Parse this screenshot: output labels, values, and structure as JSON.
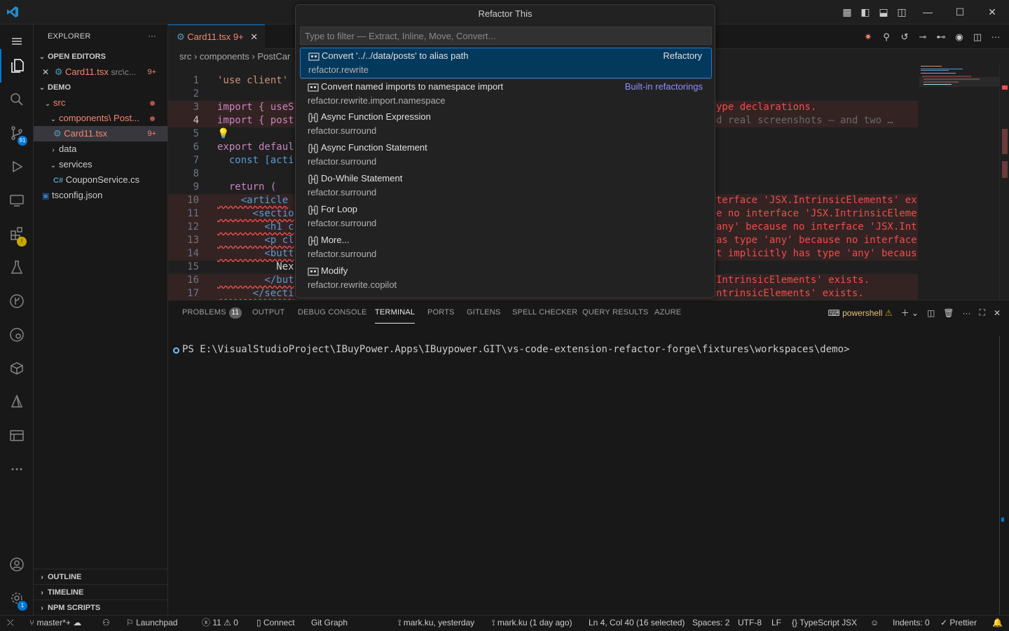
{
  "window": {
    "minimize": "—",
    "maximize": "☐",
    "close": "✕"
  },
  "sidebar": {
    "title": "EXPLORER",
    "more": "···",
    "open_editors": {
      "title": "OPEN EDITORS",
      "items": [
        {
          "name": "Card11.tsx",
          "path": "src\\c...",
          "badge": "9+"
        }
      ]
    },
    "workspace": {
      "title": "DEMO",
      "items": [
        {
          "label": "src"
        },
        {
          "label": "components\\ Post..."
        },
        {
          "label": "Card11.tsx",
          "badge": "9+"
        },
        {
          "label": "data"
        },
        {
          "label": "services"
        },
        {
          "label": "CouponService.cs"
        },
        {
          "label": "tsconfig.json"
        }
      ]
    },
    "outline": "OUTLINE",
    "timeline": "TIMELINE",
    "npm_scripts": "NPM SCRIPTS"
  },
  "activity": {
    "scm_badge": "91",
    "settings_badge": "1"
  },
  "editor": {
    "tab": {
      "name": "Card11.tsx",
      "badge": "9+"
    },
    "breadcrumb": [
      "src",
      "components",
      "PostCar"
    ],
    "lines": [
      {
        "n": "1",
        "code": "'use client'"
      },
      {
        "n": "2",
        "code": ""
      },
      {
        "n": "3",
        "code": "import { useS",
        "err": "ype declarations."
      },
      {
        "n": "4",
        "code": "import { post",
        "err": "d real screenshots — and two …"
      },
      {
        "n": "5",
        "code": "💡"
      },
      {
        "n": "6",
        "code": "export defaul"
      },
      {
        "n": "7",
        "code": "  const [acti"
      },
      {
        "n": "8",
        "code": ""
      },
      {
        "n": "9",
        "code": "  return ("
      },
      {
        "n": "10",
        "code": "    <article",
        "err": "terface 'JSX.IntrinsicElements' ex"
      },
      {
        "n": "11",
        "code": "      <sectio",
        "err": "e no interface 'JSX.IntrinsicEleme"
      },
      {
        "n": "12",
        "code": "        <h1 c",
        "err": "any' because no interface 'JSX.Int"
      },
      {
        "n": "13",
        "code": "        <p cl",
        "err": "as type 'any' because no interface"
      },
      {
        "n": "14",
        "code": "        <butt",
        "err": "t implicitly has type 'any' becaus"
      },
      {
        "n": "15",
        "code": "          Nex"
      },
      {
        "n": "16",
        "code": "        </but",
        "err": "IntrinsicElements' exists."
      },
      {
        "n": "17",
        "code": "      </secti",
        "err": "ntrinsicElements' exists."
      }
    ]
  },
  "quickpick": {
    "title": "Refactor This",
    "placeholder": "Type to filter — Extract, Inline, Move, Convert...",
    "items": [
      {
        "label": "Convert '../../data/posts' to alias path",
        "desc": "refactor.rewrite",
        "right": "Refactory",
        "icon": "wrench-icon"
      },
      {
        "label": "Convert named imports to namespace import",
        "desc": "refactor.rewrite.import.namespace",
        "right": "Built-in refactorings",
        "icon": "wrench-icon"
      },
      {
        "label": "Async Function Expression",
        "desc": "refactor.surround",
        "icon": "surround-icon"
      },
      {
        "label": "Async Function Statement",
        "desc": "refactor.surround",
        "icon": "surround-icon"
      },
      {
        "label": "Do-While Statement",
        "desc": "refactor.surround",
        "icon": "surround-icon"
      },
      {
        "label": "For Loop",
        "desc": "refactor.surround",
        "icon": "surround-icon"
      },
      {
        "label": "More...",
        "desc": "refactor.surround",
        "icon": "surround-icon"
      },
      {
        "label": "Modify",
        "desc": "refactor.rewrite.copilot",
        "icon": "wrench-icon"
      }
    ]
  },
  "panel": {
    "tabs": [
      {
        "label": "PROBLEMS",
        "badge": "11"
      },
      {
        "label": "OUTPUT"
      },
      {
        "label": "DEBUG CONSOLE"
      },
      {
        "label": "TERMINAL"
      },
      {
        "label": "PORTS"
      },
      {
        "label": "GITLENS"
      },
      {
        "label": "SPELL CHECKER"
      },
      {
        "label": "QUERY RESULTS"
      },
      {
        "label": "AZURE"
      }
    ],
    "shell": "powershell",
    "terminal_prompt": "PS E:\\VisualStudioProject\\IBuyPower.Apps\\IBuypower.GIT\\vs-code-extension-refactor-forge\\fixtures\\workspaces\\demo>"
  },
  "status": {
    "branch": "master*+",
    "launchpad": "Launchpad",
    "errors": "11",
    "warnings": "0",
    "connect": "Connect",
    "git_graph": "Git Graph",
    "blame": "mark.ku, yesterday",
    "commit": "mark.ku (1 day ago)",
    "position": "Ln 4, Col 40 (16 selected)",
    "spaces": "Spaces: 2",
    "encoding": "UTF-8",
    "eol": "LF",
    "language": "TypeScript JSX",
    "indents": "Indents: 0",
    "prettier": "Prettier"
  },
  "colors": {
    "accent": "#0078d4",
    "error": "#f14c4c",
    "selection": "#04395e"
  }
}
